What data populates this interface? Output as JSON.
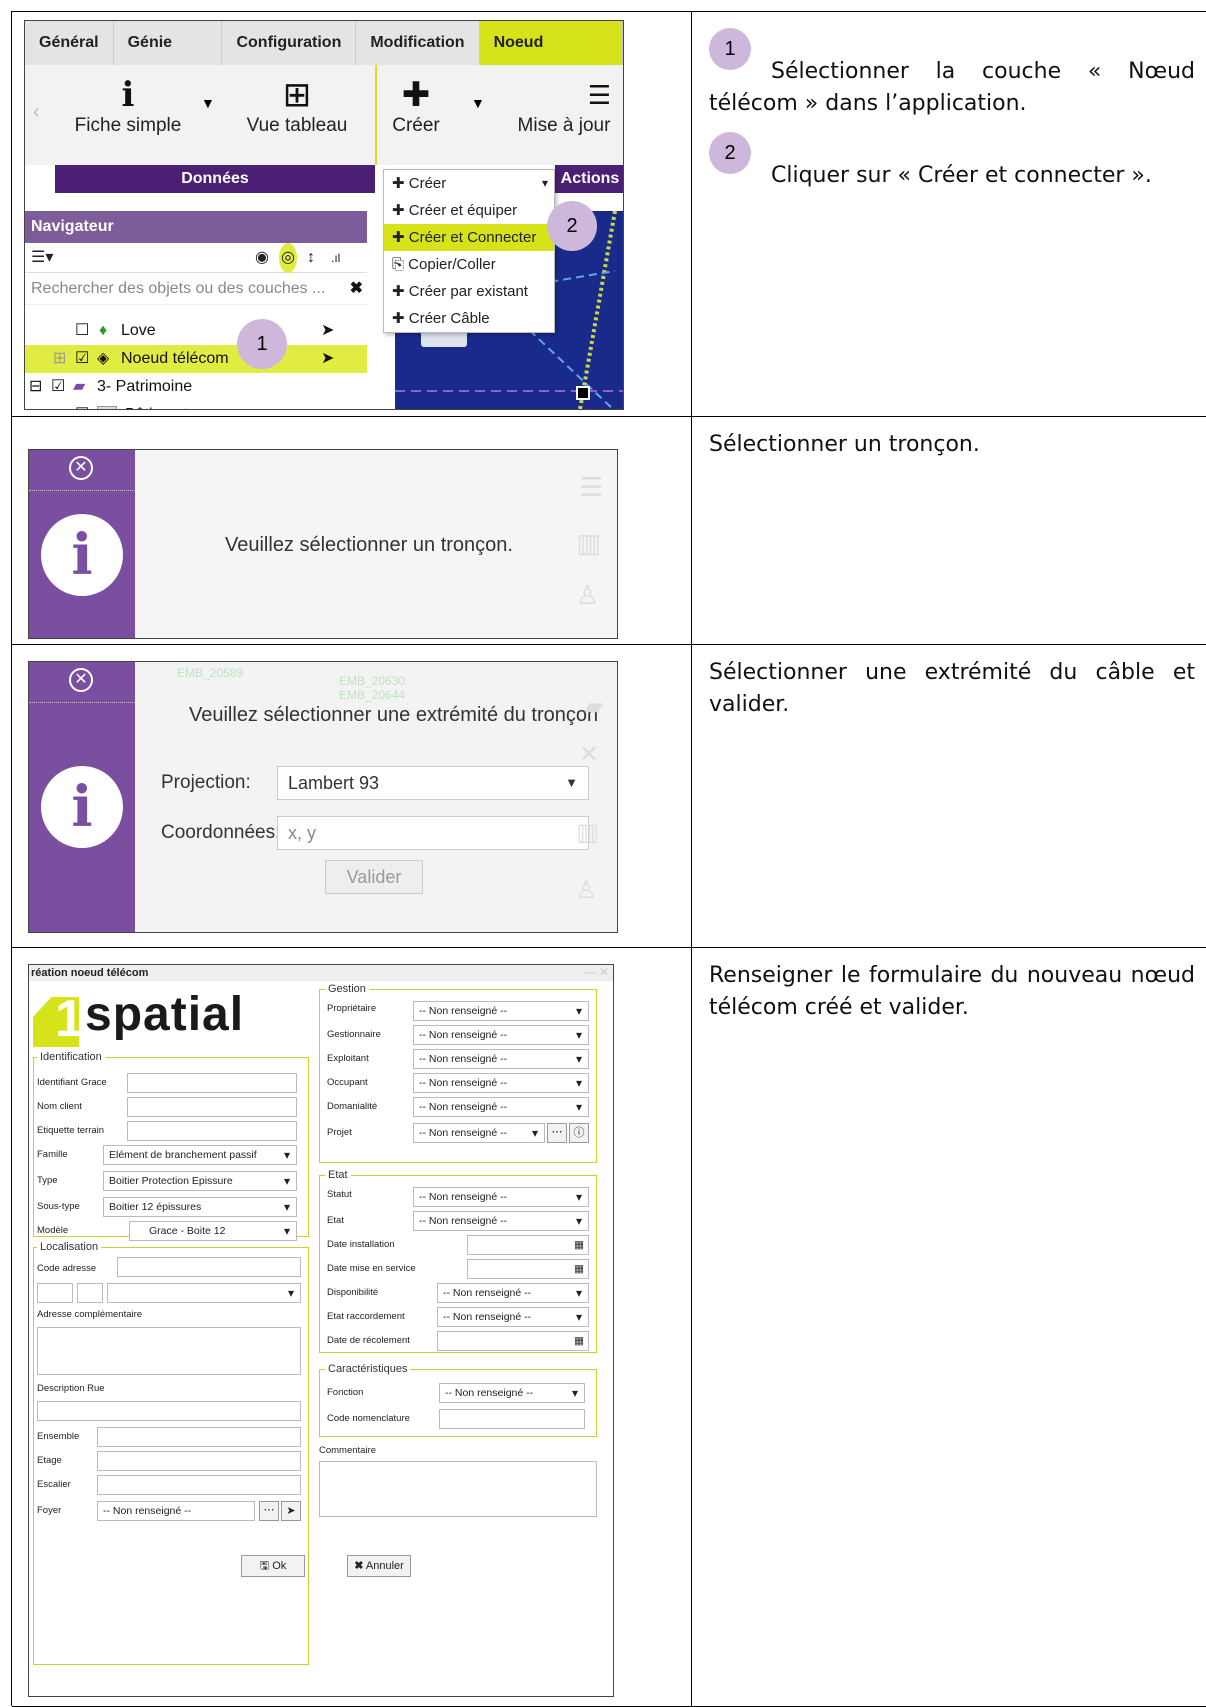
{
  "row1": {
    "tabs": [
      "Général",
      "Génie civil",
      "Configuration",
      "Modification",
      "Noeud télécom"
    ],
    "ribbon_buttons": {
      "fiche": "Fiche simple",
      "vue": "Vue tableau",
      "creer": "Créer",
      "maj": "Mise à jour"
    },
    "groups": {
      "donnees": "Données",
      "actions": "Actions"
    },
    "dropdown": [
      "Créer",
      "Créer et équiper",
      "Créer et Connecter",
      "Copier/Coller",
      "Créer par existant",
      "Créer Câble"
    ],
    "navigator": {
      "title": "Navigateur",
      "search_placeholder": "Rechercher des objets ou des couches ..."
    },
    "tree": [
      "Love",
      "Noeud télécom",
      "3- Patrimoine",
      "Bâtiment"
    ],
    "badge1": "1",
    "badge2": "2",
    "instructions": {
      "b1": "1",
      "t1": "Sélectionner la couche « Nœud télécom » dans l’application.",
      "b2": "2",
      "t2": "Cliquer sur « Créer et connecter »."
    }
  },
  "row2": {
    "message": "Veuillez sélectionner un tronçon.",
    "instruction": "Sélectionner un tronçon."
  },
  "row3": {
    "message": "Veuillez sélectionner une extrémité du tronçon",
    "projection_label": "Projection:",
    "projection_value": "Lambert 93",
    "coord_label": "Coordonnées:",
    "coord_placeholder": "x, y",
    "validate": "Valider",
    "map_labels": [
      "EMB_20589",
      "EMB_20630",
      "EMB_20644"
    ],
    "instruction": "Sélectionner une extrémité du câble et valider."
  },
  "row4": {
    "window_title": "réation noeud télécom",
    "logo_digit": "1",
    "logo_text": "spatial",
    "identification": {
      "legend": "Identification",
      "fields": [
        "Identifiant Grace",
        "Nom client",
        "Etiquette terrain"
      ],
      "famille_label": "Famille",
      "famille": "Elément de branchement passif",
      "type_label": "Type",
      "type": "Boitier Protection Epissure",
      "soustype_label": "Sous-type",
      "soustype": "Boitier 12 épissures",
      "modele_label": "Modèle",
      "modele": "Grace - Boite 12"
    },
    "localisation": {
      "legend": "Localisation",
      "code": "Code adresse",
      "adr": "Adresse complémentaire",
      "rue": "Description Rue",
      "ensemble": "Ensemble",
      "etage": "Etage",
      "escalier": "Escalier",
      "foyer": "Foyer",
      "foyer_value": "-- Non renseigné --"
    },
    "gestion": {
      "legend": "Gestion",
      "fields": [
        "Propriétaire",
        "Gestionnaire",
        "Exploitant",
        "Occupant",
        "Domanialité",
        "Projet"
      ],
      "value": "-- Non renseigné --"
    },
    "etat": {
      "legend": "Etat",
      "statut": "Statut",
      "etat": "Etat",
      "date_inst": "Date installation",
      "date_mes": "Date mise en service",
      "dispo": "Disponibilité",
      "raccord": "Etat raccordement",
      "recol": "Date de récolement",
      "value": "-- Non renseigné --"
    },
    "carac": {
      "legend": "Caractéristiques",
      "fonction": "Fonction",
      "code_nom": "Code nomenclature",
      "value": "-- Non renseigné --"
    },
    "commentaire": "Commentaire",
    "ok": "Ok",
    "annuler": "Annuler",
    "instruction": "Renseigner le formulaire du nouveau nœud télécom créé et valider."
  }
}
